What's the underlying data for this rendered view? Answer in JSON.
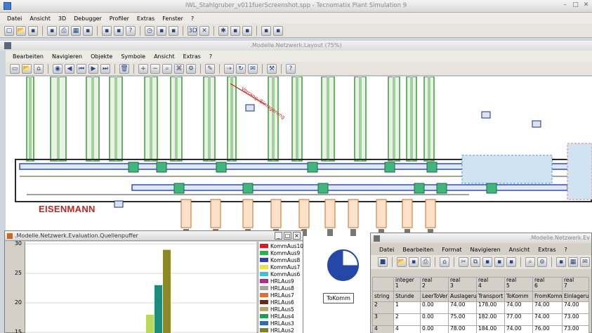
{
  "app": {
    "title": "IWL_Stahlgruber_v011fuerScreenshot.spp - Tecnomatix Plant Simulation 9",
    "menu": [
      "Datei",
      "Ansicht",
      "3D",
      "Debugger",
      "Profiler",
      "Extras",
      "Fenster",
      "?"
    ],
    "toolbar_icons": [
      "new-icon",
      "open-icon",
      "save-icon",
      "sep",
      "save-all-icon",
      "print-icon",
      "grid-icon",
      "window-icon",
      "sep",
      "library-icon",
      "model-icon",
      "help-icon",
      "sep",
      "clock-icon",
      "stopwatch-icon",
      "tools-icon",
      "sep",
      "3d-icon",
      "cross-icon",
      "sep",
      "bug-icon",
      "debug-icon",
      "profile-icon",
      "sep",
      "screen-icon",
      "window2-icon"
    ]
  },
  "layout_window": {
    "title": ".Modelle.Netzwerk.Layout  (75%)",
    "menu": [
      "Bearbeiten",
      "Navigieren",
      "Objekte",
      "Symbole",
      "Ansicht",
      "Extras",
      "?"
    ],
    "toolbar_icons": [
      "select-icon",
      "open-icon",
      "home-icon",
      "sep",
      "init-icon",
      "reset-icon",
      "step-back-icon",
      "play-icon",
      "step-icon",
      "sep",
      "trash-icon",
      "sep",
      "zoom-in-icon",
      "zoom-out-icon",
      "find-icon",
      "hierarchy-icon",
      "settings-icon",
      "sep",
      "pen-icon",
      "sep",
      "connect-icon",
      "turn-icon",
      "comment-icon",
      "sep",
      "tool-icon",
      "sep",
      "help-icon"
    ],
    "logo_text": "EISENMANN",
    "tokomm_label": "ToKomm",
    "red_note": "Vorrang-/Einlagerung"
  },
  "eval_window": {
    "title": ".Modelle.Netzwerk.Evaluation.Quellenpuffer",
    "buttons": [
      "_",
      "□",
      "×"
    ],
    "y_ticks": [
      "30",
      "25",
      "20",
      "15"
    ],
    "legend": [
      {
        "name": "KommAus10",
        "color": "#e8141c"
      },
      {
        "name": "KommAus9",
        "color": "#25b54a"
      },
      {
        "name": "KommAus8",
        "color": "#2d3fb0"
      },
      {
        "name": "KommAus7",
        "color": "#f3e23a"
      },
      {
        "name": "KommAus6",
        "color": "#36c3df"
      },
      {
        "name": "HRLAus9",
        "color": "#b02a8c"
      },
      {
        "name": "HRLAus8",
        "color": "#a4a4a4"
      },
      {
        "name": "HRLAus7",
        "color": "#e96a24"
      },
      {
        "name": "HRLAus6",
        "color": "#6a2a1a"
      },
      {
        "name": "HRLAus5",
        "color": "#b9a66a"
      },
      {
        "name": "HRLAus4",
        "color": "#17a05a"
      },
      {
        "name": "HRLAus3",
        "color": "#2a6bbf"
      },
      {
        "name": "HRLAus2",
        "color": "#7f7f2a"
      }
    ]
  },
  "chart_data": {
    "type": "bar",
    "ylim": [
      15,
      30
    ],
    "yticks": [
      15,
      20,
      25,
      30
    ],
    "bars": [
      {
        "value": 18,
        "color": "#b8d95a"
      },
      {
        "value": 23,
        "color": "#1d8c7c"
      },
      {
        "value": 29,
        "color": "#8b8a26"
      }
    ]
  },
  "table_window": {
    "title": ".Modelle.Netzwerk.Ev",
    "menu": [
      "Datei",
      "Bearbeiten",
      "Format",
      "Navigieren",
      "Ansicht",
      "Extras",
      "?"
    ],
    "toolbar_icons": [
      "stop-icon",
      "sep",
      "open-icon",
      "save-icon",
      "print-icon",
      "sep",
      "home-icon",
      "sep",
      "cut-icon",
      "copy-icon",
      "paste-icon",
      "delete-icon",
      "insert-icon",
      "sep",
      "find-icon",
      "binoculars-icon",
      "sep",
      "format-icon",
      "table-icon",
      "comment-icon"
    ],
    "type_row": [
      "",
      "integer\n1",
      "real\n2",
      "real\n3",
      "real\n4",
      "real\n5",
      "real\n6",
      "real\n7"
    ],
    "name_row": [
      "string",
      "Stunde",
      "LeerToVer",
      "Auslageru",
      "Transport",
      "ToKomm",
      "FromKomm",
      "Einlagerun"
    ],
    "rows": [
      [
        "2",
        "1",
        "0.00",
        "74.00",
        "178.00",
        "74.00",
        "74.00",
        "74.00"
      ],
      [
        "3",
        "2",
        "0.00",
        "75.00",
        "182.00",
        "77.00",
        "74.00",
        "73.00"
      ],
      [
        "4",
        "4",
        "0.00",
        "78.00",
        "184.00",
        "74.00",
        "76.00",
        "73.00"
      ]
    ]
  }
}
